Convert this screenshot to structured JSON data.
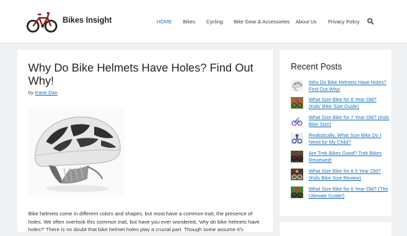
{
  "site": {
    "title": "Bikes Insight"
  },
  "nav": [
    {
      "label": "HOME"
    },
    {
      "label": "Bikes"
    },
    {
      "label": "Cycling"
    },
    {
      "label": "Bike Gear & Accessories"
    },
    {
      "label": "About Us"
    },
    {
      "label": "Privacy Policy"
    }
  ],
  "colors": {
    "link": "#1e73be",
    "background": "#eff1f3"
  },
  "icons": {
    "search": "search-icon",
    "logo": "bicycle-logo"
  },
  "article": {
    "title": "Why Do Bike Helmets Have Holes? Find Out Why!",
    "by": "by",
    "author": "Kane Dan",
    "body": "Bike helmets come in different colors and shapes, but most have a common trait, the presence of holes. We often overlook this common trait, but have you ever wondered, 'why do bike helmets have holes?'  There is no doubt that bike helmet holes play a crucial part. Though some assume it's"
  },
  "sidebar": {
    "title": "Recent Posts",
    "posts": [
      {
        "title": "Why Do Bike Helmets Have Holes? Find Out Why!",
        "thumb": "helmet"
      },
      {
        "title": "What Size Bike for 8 Year Old? (Kids' Bike Size Guide)",
        "thumb": "kid-bike"
      },
      {
        "title": "What Size Bike for 7 Year Old? (Kids Bike Size)",
        "thumb": "balance-bike"
      },
      {
        "title": "Realistically, What Size Bike Do I Need for My Child?",
        "thumb": "child-riding"
      },
      {
        "title": "Are Trek Bikes Good? Trek Bikes Reviewed!",
        "thumb": "trek-bike"
      },
      {
        "title": "What Size Bike for A 5 Year Old? (Kids Bike Size Review)",
        "thumb": "kid-bike-2"
      },
      {
        "title": "What Size Bike for 6 Year Old? (The Ultimate Guide!)",
        "thumb": "kid-bike-3"
      }
    ]
  }
}
